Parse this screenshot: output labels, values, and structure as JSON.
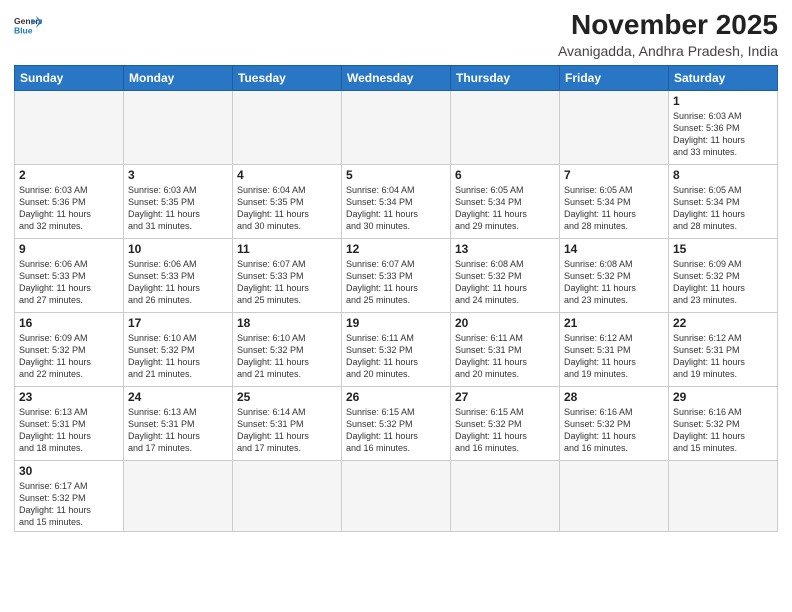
{
  "header": {
    "logo_general": "General",
    "logo_blue": "Blue",
    "month_title": "November 2025",
    "location": "Avanigadda, Andhra Pradesh, India"
  },
  "weekdays": [
    "Sunday",
    "Monday",
    "Tuesday",
    "Wednesday",
    "Thursday",
    "Friday",
    "Saturday"
  ],
  "weeks": [
    [
      {
        "day": "",
        "text": ""
      },
      {
        "day": "",
        "text": ""
      },
      {
        "day": "",
        "text": ""
      },
      {
        "day": "",
        "text": ""
      },
      {
        "day": "",
        "text": ""
      },
      {
        "day": "",
        "text": ""
      },
      {
        "day": "1",
        "text": "Sunrise: 6:03 AM\nSunset: 5:36 PM\nDaylight: 11 hours\nand 33 minutes."
      }
    ],
    [
      {
        "day": "2",
        "text": "Sunrise: 6:03 AM\nSunset: 5:36 PM\nDaylight: 11 hours\nand 32 minutes."
      },
      {
        "day": "3",
        "text": "Sunrise: 6:03 AM\nSunset: 5:35 PM\nDaylight: 11 hours\nand 31 minutes."
      },
      {
        "day": "4",
        "text": "Sunrise: 6:04 AM\nSunset: 5:35 PM\nDaylight: 11 hours\nand 30 minutes."
      },
      {
        "day": "5",
        "text": "Sunrise: 6:04 AM\nSunset: 5:34 PM\nDaylight: 11 hours\nand 30 minutes."
      },
      {
        "day": "6",
        "text": "Sunrise: 6:05 AM\nSunset: 5:34 PM\nDaylight: 11 hours\nand 29 minutes."
      },
      {
        "day": "7",
        "text": "Sunrise: 6:05 AM\nSunset: 5:34 PM\nDaylight: 11 hours\nand 28 minutes."
      },
      {
        "day": "8",
        "text": "Sunrise: 6:05 AM\nSunset: 5:34 PM\nDaylight: 11 hours\nand 28 minutes."
      }
    ],
    [
      {
        "day": "9",
        "text": "Sunrise: 6:06 AM\nSunset: 5:33 PM\nDaylight: 11 hours\nand 27 minutes."
      },
      {
        "day": "10",
        "text": "Sunrise: 6:06 AM\nSunset: 5:33 PM\nDaylight: 11 hours\nand 26 minutes."
      },
      {
        "day": "11",
        "text": "Sunrise: 6:07 AM\nSunset: 5:33 PM\nDaylight: 11 hours\nand 25 minutes."
      },
      {
        "day": "12",
        "text": "Sunrise: 6:07 AM\nSunset: 5:33 PM\nDaylight: 11 hours\nand 25 minutes."
      },
      {
        "day": "13",
        "text": "Sunrise: 6:08 AM\nSunset: 5:32 PM\nDaylight: 11 hours\nand 24 minutes."
      },
      {
        "day": "14",
        "text": "Sunrise: 6:08 AM\nSunset: 5:32 PM\nDaylight: 11 hours\nand 23 minutes."
      },
      {
        "day": "15",
        "text": "Sunrise: 6:09 AM\nSunset: 5:32 PM\nDaylight: 11 hours\nand 23 minutes."
      }
    ],
    [
      {
        "day": "16",
        "text": "Sunrise: 6:09 AM\nSunset: 5:32 PM\nDaylight: 11 hours\nand 22 minutes."
      },
      {
        "day": "17",
        "text": "Sunrise: 6:10 AM\nSunset: 5:32 PM\nDaylight: 11 hours\nand 21 minutes."
      },
      {
        "day": "18",
        "text": "Sunrise: 6:10 AM\nSunset: 5:32 PM\nDaylight: 11 hours\nand 21 minutes."
      },
      {
        "day": "19",
        "text": "Sunrise: 6:11 AM\nSunset: 5:32 PM\nDaylight: 11 hours\nand 20 minutes."
      },
      {
        "day": "20",
        "text": "Sunrise: 6:11 AM\nSunset: 5:31 PM\nDaylight: 11 hours\nand 20 minutes."
      },
      {
        "day": "21",
        "text": "Sunrise: 6:12 AM\nSunset: 5:31 PM\nDaylight: 11 hours\nand 19 minutes."
      },
      {
        "day": "22",
        "text": "Sunrise: 6:12 AM\nSunset: 5:31 PM\nDaylight: 11 hours\nand 19 minutes."
      }
    ],
    [
      {
        "day": "23",
        "text": "Sunrise: 6:13 AM\nSunset: 5:31 PM\nDaylight: 11 hours\nand 18 minutes."
      },
      {
        "day": "24",
        "text": "Sunrise: 6:13 AM\nSunset: 5:31 PM\nDaylight: 11 hours\nand 17 minutes."
      },
      {
        "day": "25",
        "text": "Sunrise: 6:14 AM\nSunset: 5:31 PM\nDaylight: 11 hours\nand 17 minutes."
      },
      {
        "day": "26",
        "text": "Sunrise: 6:15 AM\nSunset: 5:32 PM\nDaylight: 11 hours\nand 16 minutes."
      },
      {
        "day": "27",
        "text": "Sunrise: 6:15 AM\nSunset: 5:32 PM\nDaylight: 11 hours\nand 16 minutes."
      },
      {
        "day": "28",
        "text": "Sunrise: 6:16 AM\nSunset: 5:32 PM\nDaylight: 11 hours\nand 16 minutes."
      },
      {
        "day": "29",
        "text": "Sunrise: 6:16 AM\nSunset: 5:32 PM\nDaylight: 11 hours\nand 15 minutes."
      }
    ],
    [
      {
        "day": "30",
        "text": "Sunrise: 6:17 AM\nSunset: 5:32 PM\nDaylight: 11 hours\nand 15 minutes."
      },
      {
        "day": "",
        "text": ""
      },
      {
        "day": "",
        "text": ""
      },
      {
        "day": "",
        "text": ""
      },
      {
        "day": "",
        "text": ""
      },
      {
        "day": "",
        "text": ""
      },
      {
        "day": "",
        "text": ""
      }
    ]
  ]
}
